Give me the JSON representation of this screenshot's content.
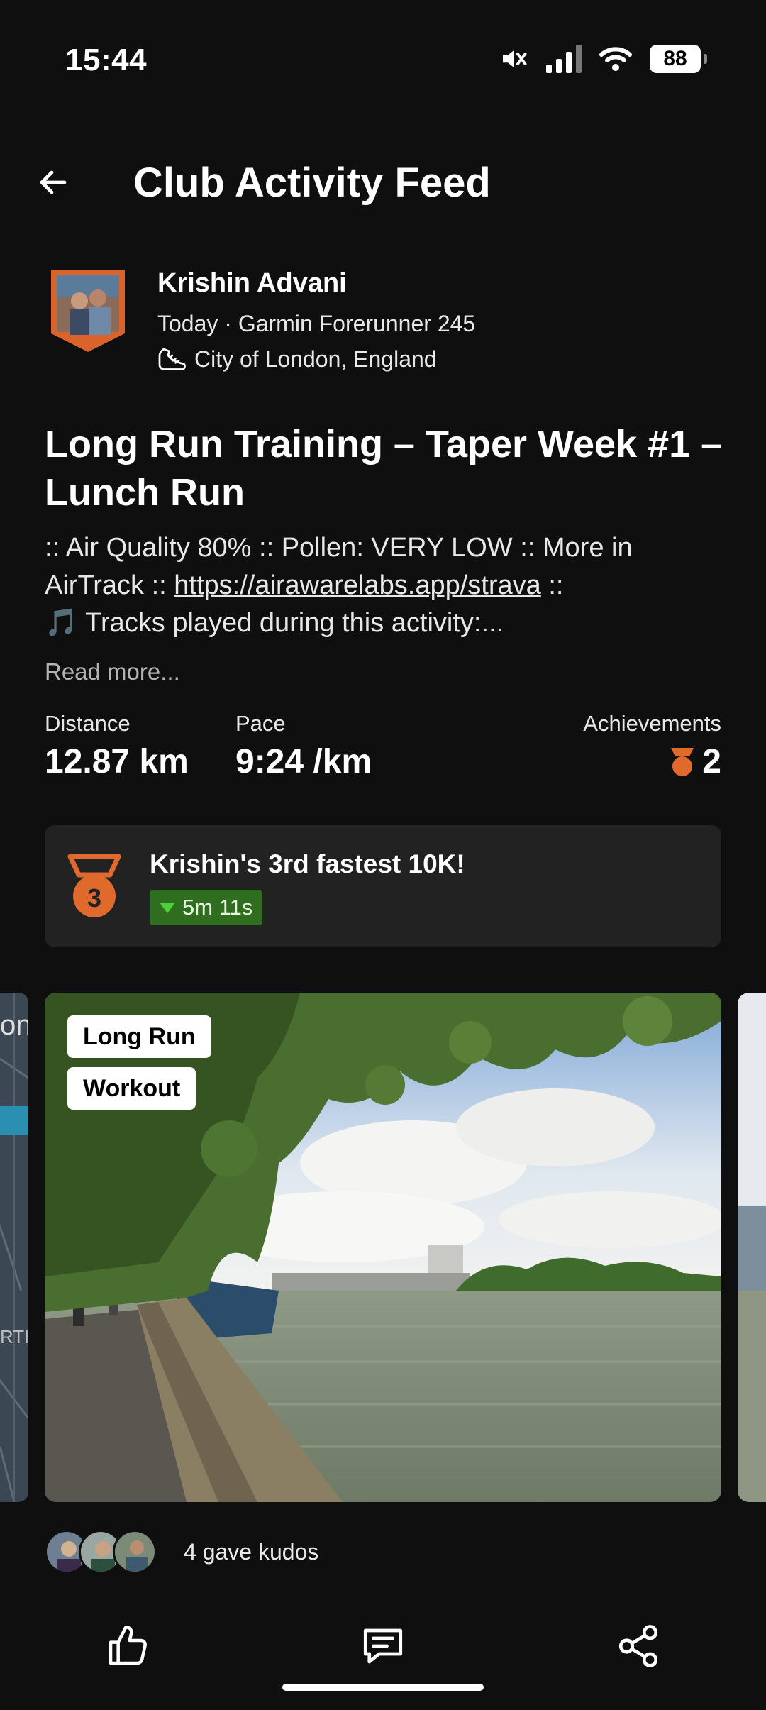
{
  "status_bar": {
    "time": "15:44",
    "battery": "88"
  },
  "header": {
    "title": "Club Activity Feed"
  },
  "athlete": {
    "name": "Krishin Advani",
    "meta": "Today · Garmin Forerunner 245",
    "location": "City of London, England"
  },
  "activity": {
    "title": "Long Run Training – Taper Week #1 – Lunch Run",
    "desc_line1": ":: Air Quality 80% :: Pollen: VERY LOW :: More in",
    "desc_line2_prefix": "AirTrack :: ",
    "desc_link": "https://airawarelabs.app/strava",
    "desc_line2_suffix": " ::",
    "desc_line3": "🎵 Tracks played during this activity:...",
    "read_more": "Read more..."
  },
  "stats": {
    "distance_label": "Distance",
    "distance_value": "12.87 km",
    "pace_label": "Pace",
    "pace_value": "9:24 /km",
    "achievements_label": "Achievements",
    "achievements_value": "2"
  },
  "achievement": {
    "title": "Krishin's 3rd fastest 10K!",
    "medal_number": "3",
    "delta": "5m 11s"
  },
  "photos": {
    "tags": [
      "Long Run",
      "Workout"
    ],
    "map_text": "on",
    "map_text2": "RTH"
  },
  "kudos": {
    "text": "4 gave kudos"
  },
  "colors": {
    "accent_orange": "#e06a2c",
    "badge_green": "#2f6e1e",
    "background": "#0f0f0f"
  }
}
